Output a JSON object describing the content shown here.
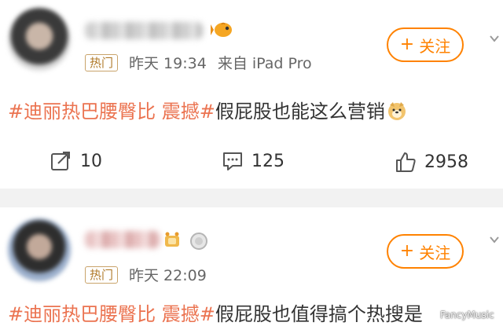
{
  "posts": [
    {
      "tag": "热门",
      "time": "昨天 19:34",
      "source": "来自 iPad Pro",
      "follow_label": "关注",
      "follow_plus": "+",
      "hashtag": "#迪丽热巴腰臀比 震撼#",
      "text": "假屁股也能这么营销",
      "stats": {
        "repost": "10",
        "comment": "125",
        "like": "2958"
      }
    },
    {
      "tag": "热门",
      "time": "昨天 22:09",
      "follow_label": "关注",
      "follow_plus": "+",
      "hashtag": "#迪丽热巴腰臀比 震撼#",
      "text": "假屁股也值得搞个热搜是"
    }
  ],
  "watermark": "FancyMusic",
  "colors": {
    "accent": "#ff8200",
    "hashtag": "#eb7350",
    "hot_tag": "#b07a2a",
    "separator": "#f2f2f2"
  },
  "icons": [
    "fish-badge-icon",
    "chevron-down-icon",
    "repost-icon",
    "comment-icon",
    "like-icon",
    "doge-emoji-icon",
    "pin-badge-icon",
    "medal-badge-icon"
  ]
}
